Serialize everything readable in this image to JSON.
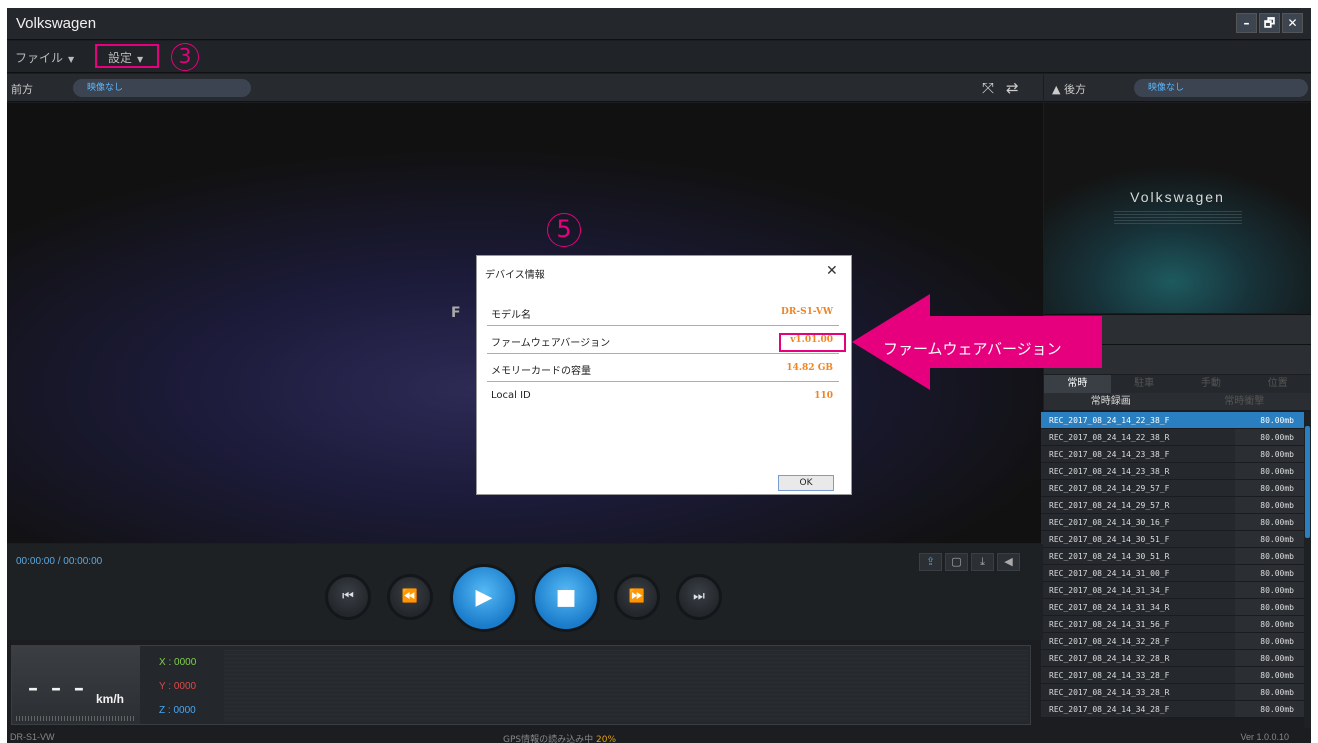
{
  "app": {
    "title": "Volkswagen"
  },
  "window_controls": {
    "minimize": "–",
    "restore": "🗗",
    "close": "✕"
  },
  "menu": {
    "file": "ファイル",
    "settings": "設定",
    "annot_num": "3"
  },
  "front_panel": {
    "label": "前方",
    "status": "映像なし",
    "logo_partial": "F"
  },
  "rear_panel": {
    "label": "▲ 後方",
    "status": "映像なし",
    "logo": "Volkswagen"
  },
  "dialog": {
    "annot_num": "5",
    "title": "デバイス情報",
    "close": "✕",
    "rows": [
      {
        "label": "モデル名",
        "value": "DR-S1-VW"
      },
      {
        "label": "ファームウェアバージョン",
        "value": "v1.01.00"
      },
      {
        "label": "メモリーカードの容量",
        "value": "14.82 GB"
      },
      {
        "label": "Local ID",
        "value": "110"
      }
    ],
    "ok": "OK"
  },
  "annotation": {
    "arrow_text": "ファームウェアバージョン",
    "color": "#e6007e"
  },
  "player": {
    "time": "00:00:00 / 00:00:00",
    "buttons": [
      "⏮",
      "⏪",
      "▶",
      "■",
      "⏩",
      "⏭"
    ]
  },
  "gps": {
    "speed": "– – –",
    "unit": "km/h",
    "x": "X : 0000",
    "y": "Y : 0000",
    "z": "Z : 0000"
  },
  "status": {
    "device": "DR-S1-VW",
    "loading": "GPS情報の読み込み中",
    "loading_pct": "20%",
    "version": "Ver 1.0.0.10"
  },
  "list": {
    "tabs": [
      "常時",
      "駐車",
      "手動",
      "位置"
    ],
    "subtabs": [
      "常時録画",
      "常時衝撃"
    ],
    "files": [
      {
        "name": "REC_2017_08_24_14_22_38_F",
        "size": "80.00mb"
      },
      {
        "name": "REC_2017_08_24_14_22_38_R",
        "size": "80.00mb"
      },
      {
        "name": "REC_2017_08_24_14_23_38_F",
        "size": "80.00mb"
      },
      {
        "name": "REC_2017_08_24_14_23_38_R",
        "size": "80.00mb"
      },
      {
        "name": "REC_2017_08_24_14_29_57_F",
        "size": "80.00mb"
      },
      {
        "name": "REC_2017_08_24_14_29_57_R",
        "size": "80.00mb"
      },
      {
        "name": "REC_2017_08_24_14_30_16_F",
        "size": "80.00mb"
      },
      {
        "name": "REC_2017_08_24_14_30_51_F",
        "size": "80.00mb"
      },
      {
        "name": "REC_2017_08_24_14_30_51_R",
        "size": "80.00mb"
      },
      {
        "name": "REC_2017_08_24_14_31_00_F",
        "size": "80.00mb"
      },
      {
        "name": "REC_2017_08_24_14_31_34_F",
        "size": "80.00mb"
      },
      {
        "name": "REC_2017_08_24_14_31_34_R",
        "size": "80.00mb"
      },
      {
        "name": "REC_2017_08_24_14_31_56_F",
        "size": "80.00mb"
      },
      {
        "name": "REC_2017_08_24_14_32_28_F",
        "size": "80.00mb"
      },
      {
        "name": "REC_2017_08_24_14_32_28_R",
        "size": "80.00mb"
      },
      {
        "name": "REC_2017_08_24_14_33_28_F",
        "size": "80.00mb"
      },
      {
        "name": "REC_2017_08_24_14_33_28_R",
        "size": "80.00mb"
      },
      {
        "name": "REC_2017_08_24_14_34_28_F",
        "size": "80.00mb"
      }
    ]
  }
}
